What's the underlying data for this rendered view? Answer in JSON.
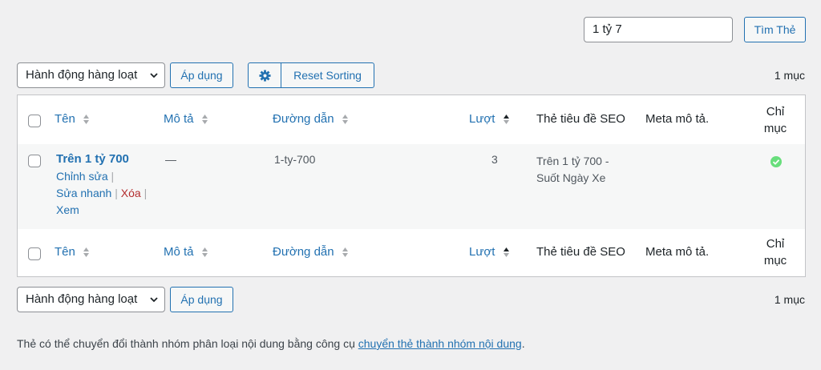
{
  "search": {
    "value": "1 tỷ 7",
    "button_label": "Tìm Thẻ"
  },
  "toolbar_top": {
    "bulk_action": "Hành động hàng loạt",
    "apply_label": "Áp dụng",
    "reset_sorting_label": "Reset Sorting",
    "count": "1 mục"
  },
  "toolbar_bottom": {
    "bulk_action": "Hành động hàng loạt",
    "apply_label": "Áp dụng",
    "count": "1 mục"
  },
  "table": {
    "columns": {
      "name": "Tên",
      "description": "Mô tả",
      "slug": "Đường dẫn",
      "count": "Lượt",
      "seo_title": "Thẻ tiêu đề SEO",
      "meta": "Meta mô tả.",
      "index_line1": "Chỉ",
      "index_line2": "mục"
    },
    "rows": [
      {
        "name": "Trên 1 tỷ 700",
        "description": "—",
        "slug": "1-ty-700",
        "count": "3",
        "seo_title_line1": "Trên 1 tỷ 700 -",
        "seo_title_line2": "Suốt Ngày Xe",
        "actions": {
          "edit": "Chỉnh sửa",
          "quick_edit": "Sửa nhanh",
          "delete": "Xóa",
          "view": "Xem",
          "separator": "|"
        },
        "indexed": true
      }
    ]
  },
  "footnote": {
    "text": "Thẻ có thể chuyển đổi thành nhóm phân loại nội dung bằng công cụ ",
    "link": "chuyển thẻ thành nhóm nội dung",
    "end": "."
  },
  "colors": {
    "link": "#2271b1",
    "delete": "#b32d2e",
    "indexed_ok": "#68de7c"
  }
}
